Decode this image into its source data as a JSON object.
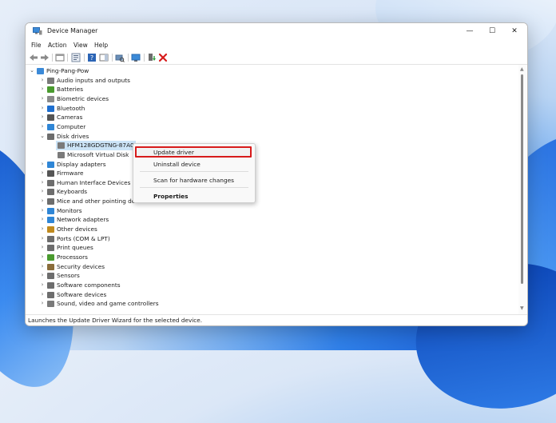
{
  "window": {
    "title": "Device Manager",
    "controls": {
      "minimize": "—",
      "maximize": "☐",
      "close": "✕"
    }
  },
  "menu": [
    "File",
    "Action",
    "View",
    "Help"
  ],
  "toolbar": {
    "icons": [
      "back-arrow-icon",
      "forward-arrow-icon",
      "show-hide-console-icon",
      "properties-icon",
      "help-icon",
      "action-pane-icon",
      "scan-hardware-icon",
      "update-driver-icon",
      "disable-device-icon",
      "uninstall-icon"
    ],
    "uninstall_color": "#d71b1b"
  },
  "tree": {
    "root": "Ping-Pang-Pow",
    "categories": [
      {
        "label": "Audio inputs and outputs",
        "icon": "speaker-icon",
        "color": "#7a7a7a"
      },
      {
        "label": "Batteries",
        "icon": "battery-icon",
        "color": "#4a9b2f"
      },
      {
        "label": "Biometric devices",
        "icon": "fingerprint-icon",
        "color": "#8a8a8a"
      },
      {
        "label": "Bluetooth",
        "icon": "bluetooth-icon",
        "color": "#1e6fd0"
      },
      {
        "label": "Cameras",
        "icon": "camera-icon",
        "color": "#555555"
      },
      {
        "label": "Computer",
        "icon": "monitor-icon",
        "color": "#2f86d6"
      },
      {
        "label": "Disk drives",
        "icon": "disk-drive-icon",
        "color": "#6d6d6d",
        "expanded": true,
        "children": [
          {
            "label": "HFM128GDGTNG-87A0A",
            "selected": true
          },
          {
            "label": "Microsoft Virtual Disk"
          }
        ]
      },
      {
        "label": "Display adapters",
        "icon": "display-adapter-icon",
        "color": "#2f86d6"
      },
      {
        "label": "Firmware",
        "icon": "chip-icon",
        "color": "#555555"
      },
      {
        "label": "Human Interface Devices",
        "icon": "hid-icon",
        "color": "#6d6d6d"
      },
      {
        "label": "Keyboards",
        "icon": "keyboard-icon",
        "color": "#6d6d6d"
      },
      {
        "label": "Mice and other pointing devices",
        "icon": "mouse-icon",
        "color": "#6d6d6d"
      },
      {
        "label": "Monitors",
        "icon": "monitor-icon",
        "color": "#2f86d6"
      },
      {
        "label": "Network adapters",
        "icon": "network-icon",
        "color": "#2f86d6"
      },
      {
        "label": "Other devices",
        "icon": "unknown-device-icon",
        "color": "#c08a1e"
      },
      {
        "label": "Ports (COM & LPT)",
        "icon": "port-icon",
        "color": "#6d6d6d"
      },
      {
        "label": "Print queues",
        "icon": "printer-icon",
        "color": "#6d6d6d"
      },
      {
        "label": "Processors",
        "icon": "processor-icon",
        "color": "#4a9b2f"
      },
      {
        "label": "Security devices",
        "icon": "security-icon",
        "color": "#8a6d3b"
      },
      {
        "label": "Sensors",
        "icon": "sensor-icon",
        "color": "#6d6d6d"
      },
      {
        "label": "Software components",
        "icon": "component-icon",
        "color": "#6d6d6d"
      },
      {
        "label": "Software devices",
        "icon": "software-device-icon",
        "color": "#6d6d6d"
      },
      {
        "label": "Sound, video and game controllers",
        "icon": "sound-icon",
        "color": "#7a7a7a"
      }
    ]
  },
  "context_menu": {
    "items": [
      "Update driver",
      "Uninstall device",
      "Scan for hardware changes",
      "Properties"
    ],
    "highlight_color": "#d71b1b"
  },
  "status_bar": "Launches the Update Driver Wizard for the selected device."
}
